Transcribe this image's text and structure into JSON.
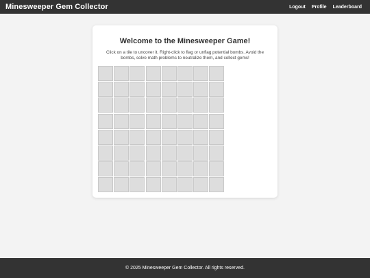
{
  "nav": {
    "brand": "Minesweeper Gem Collector",
    "links": [
      "Logout",
      "Profile",
      "Leaderboard"
    ]
  },
  "main": {
    "title": "Welcome to the Minesweeper Game!",
    "instructions": "Click on a tile to uncover it. Right-click to flag or unflag potential bombs. Avoid the bombs, solve math problems to neutralize them, and collect gems!"
  },
  "board": {
    "rows": 8,
    "cols": 8,
    "tile_state": "covered"
  },
  "footer": {
    "text": "© 2025 Minesweeper Gem Collector. All rights reserved."
  },
  "colors": {
    "header_bg": "#333333",
    "page_bg": "#f3f3f3",
    "tile_bg": "#dddddd"
  }
}
